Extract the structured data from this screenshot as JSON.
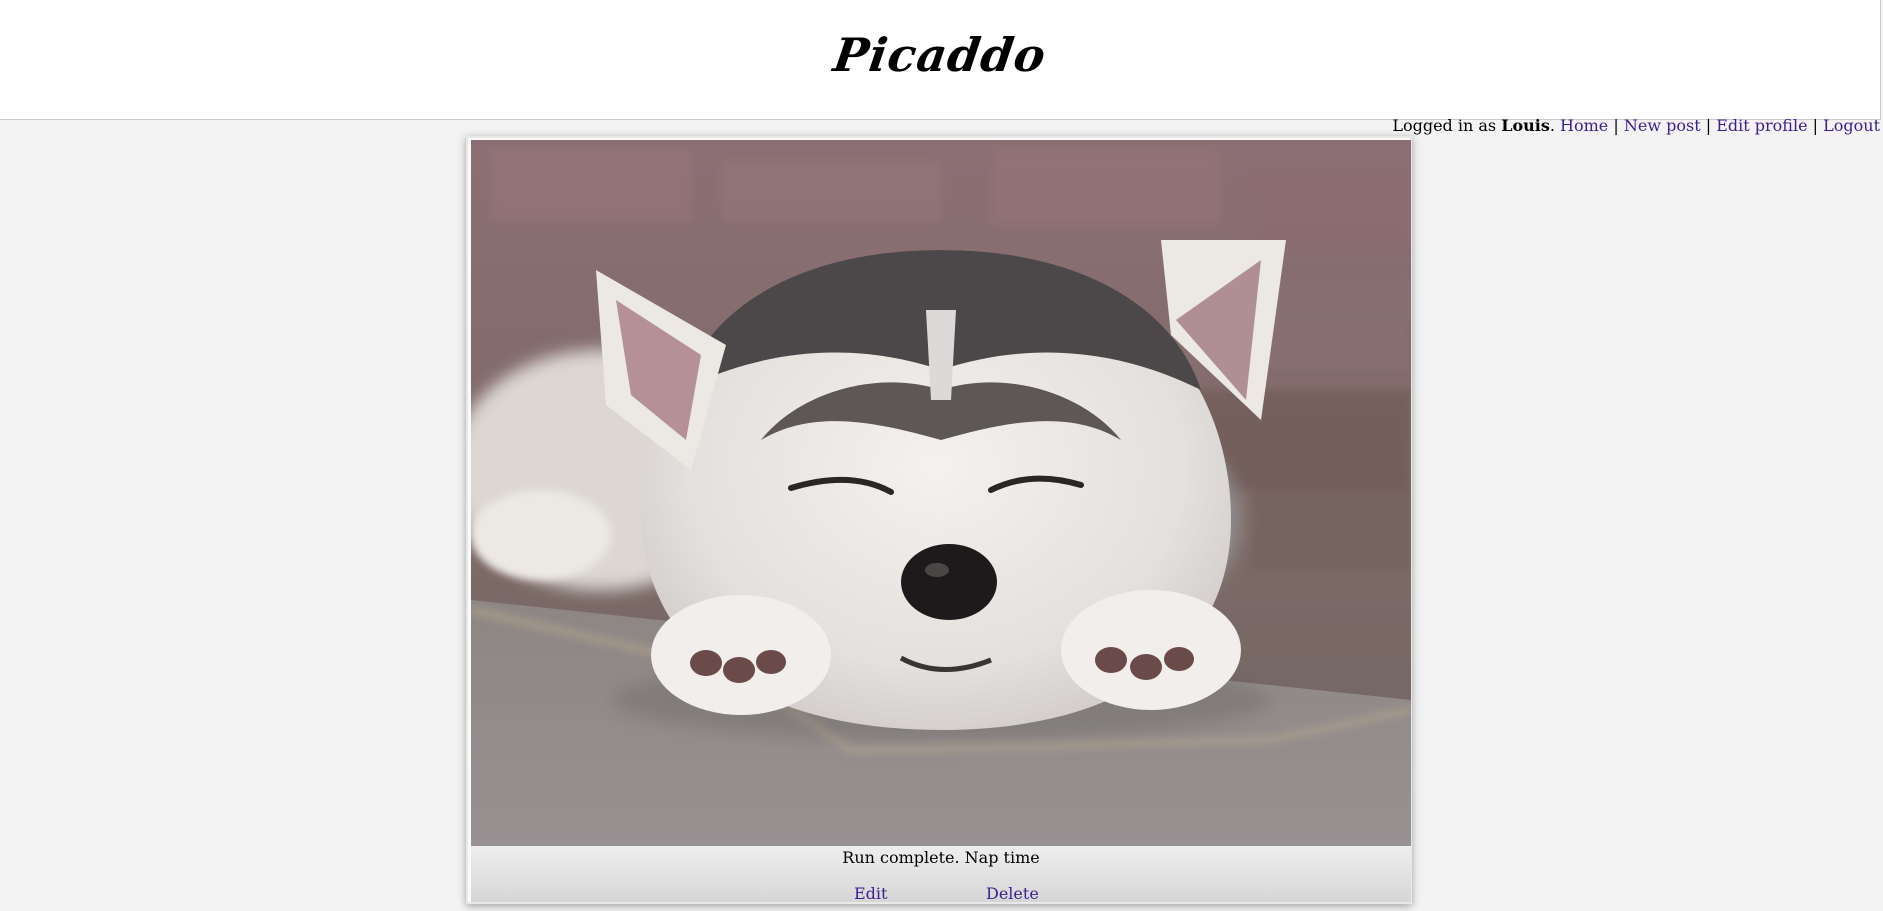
{
  "header": {
    "logo": "Picaddo"
  },
  "user_nav": {
    "prefix": "Logged in as ",
    "username": "Louis",
    "after_name": ".",
    "links": [
      "Home",
      "New post",
      "Edit profile",
      "Logout"
    ],
    "separator": "|"
  },
  "post": {
    "image_alt": "Sleeping husky puppy lying on pavement against a brick wall",
    "caption": "Run complete. Nap time",
    "edit_label": "Edit",
    "delete_label": "Delete"
  },
  "colors": {
    "link": "#3d1e8e",
    "background": "#f3f3f3",
    "header_bg": "#ffffff"
  }
}
